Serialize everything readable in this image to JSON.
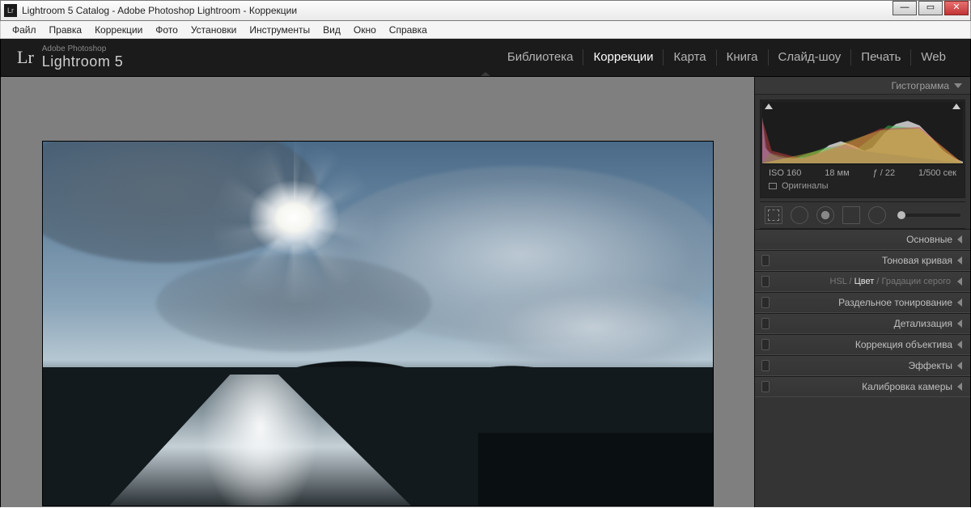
{
  "window": {
    "title": "Lightroom 5 Catalog - Adobe Photoshop Lightroom - Коррекции",
    "icon_text": "Lr"
  },
  "menu": [
    "Файл",
    "Правка",
    "Коррекции",
    "Фото",
    "Установки",
    "Инструменты",
    "Вид",
    "Окно",
    "Справка"
  ],
  "identity": {
    "superscript": "Adobe Photoshop",
    "product": "Lightroom 5",
    "mark": "Lr"
  },
  "modules": [
    {
      "label": "Библиотека",
      "active": false
    },
    {
      "label": "Коррекции",
      "active": true
    },
    {
      "label": "Карта",
      "active": false
    },
    {
      "label": "Книга",
      "active": false
    },
    {
      "label": "Слайд-шоу",
      "active": false
    },
    {
      "label": "Печать",
      "active": false
    },
    {
      "label": "Web",
      "active": false
    }
  ],
  "histogram": {
    "header": "Гистограмма",
    "iso": "ISO 160",
    "focal": "18 мм",
    "aperture": "ƒ / 22",
    "shutter": "1/500 сек",
    "originals": "Оригиналы"
  },
  "tools": [
    "crop",
    "spot-removal",
    "redeye",
    "graduated-filter",
    "radial-filter",
    "adjustment-brush"
  ],
  "panels": [
    {
      "label": "Основные",
      "switch": false
    },
    {
      "label": "Тоновая кривая",
      "switch": true
    },
    {
      "tabs": {
        "hsl": "HSL",
        "color": "Цвет",
        "bw": "Градации серого",
        "sep": " / "
      },
      "switch": true
    },
    {
      "label": "Раздельное тонирование",
      "switch": true
    },
    {
      "label": "Детализация",
      "switch": true
    },
    {
      "label": "Коррекция объектива",
      "switch": true
    },
    {
      "label": "Эффекты",
      "switch": true
    },
    {
      "label": "Калибровка камеры",
      "switch": true
    }
  ]
}
